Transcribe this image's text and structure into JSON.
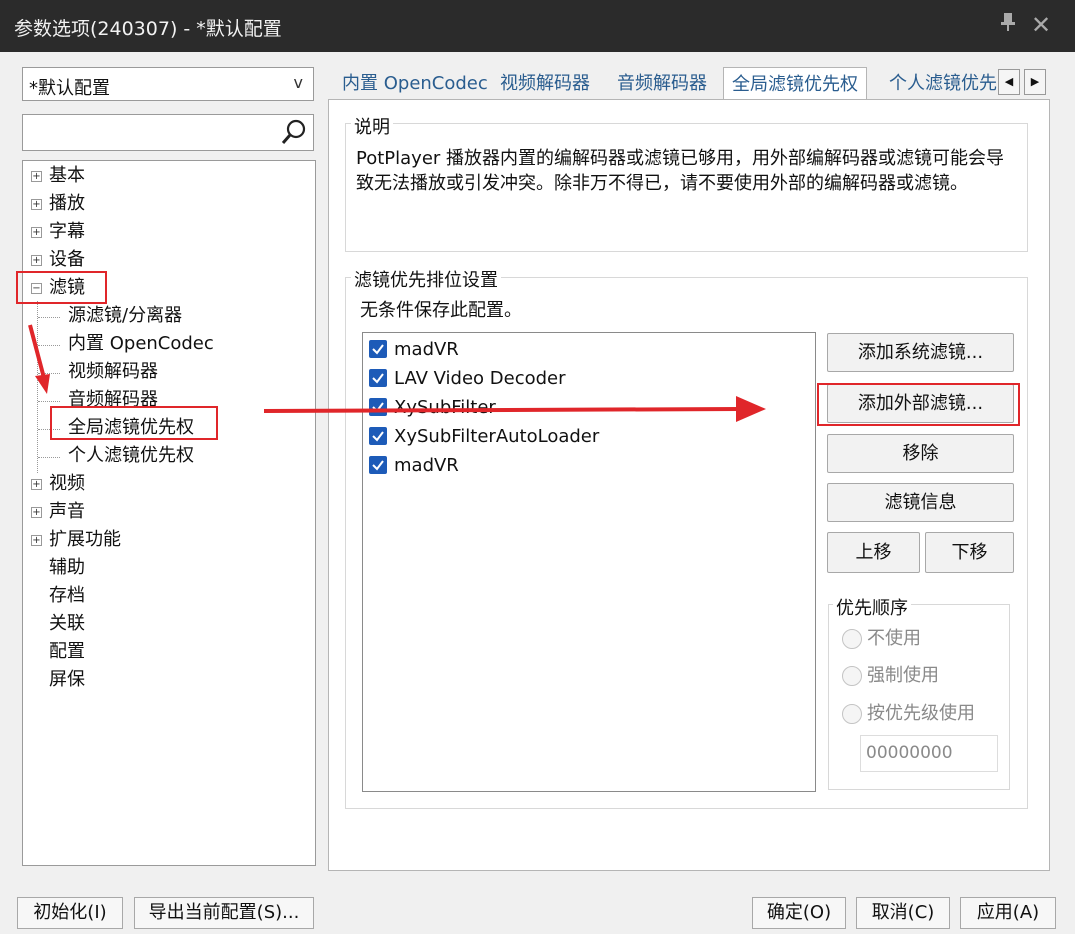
{
  "window": {
    "title": "参数选项(240307) - *默认配置"
  },
  "left": {
    "preset": "*默认配置",
    "dropdown_glyph": "v",
    "search_value": "",
    "tree": {
      "basic": "基本",
      "playback": "播放",
      "subtitle": "字幕",
      "device": "设备",
      "filter": "滤镜",
      "source_filter": "源滤镜/分离器",
      "builtin_opencodec": "内置 OpenCodec",
      "video_decoder": "视频解码器",
      "audio_decoder": "音频解码器",
      "global_priority": "全局滤镜优先权",
      "personal_priority": "个人滤镜优先权",
      "video": "视频",
      "audio": "声音",
      "extensions": "扩展功能",
      "aux": "辅助",
      "archive": "存档",
      "association": "关联",
      "config": "配置",
      "screensaver": "屏保"
    }
  },
  "tabs": [
    "内置 OpenCodec",
    "视频解码器",
    "音频解码器",
    "全局滤镜优先权",
    "个人滤镜优先"
  ],
  "description": {
    "title": "说明",
    "text": "PotPlayer 播放器内置的编解码器或滤镜已够用，用外部编解码器或滤镜可能会导致无法播放或引发冲突。除非万不得已，请不要使用外部的编解码器或滤镜。"
  },
  "priority_group": {
    "title": "滤镜优先排位设置",
    "note": "无条件保存此配置。",
    "filters": [
      {
        "name": "madVR",
        "checked": true
      },
      {
        "name": "LAV Video Decoder",
        "checked": true
      },
      {
        "name": "XySubFilter",
        "checked": true
      },
      {
        "name": "XySubFilterAutoLoader",
        "checked": true
      },
      {
        "name": "madVR",
        "checked": true
      }
    ],
    "buttons": {
      "add_system": "添加系统滤镜...",
      "add_external": "添加外部滤镜...",
      "remove": "移除",
      "info": "滤镜信息",
      "up": "上移",
      "down": "下移"
    },
    "order": {
      "title": "优先顺序",
      "options": [
        "不使用",
        "强制使用",
        "按优先级使用"
      ],
      "value": "00000000"
    }
  },
  "footer": {
    "reset": "初始化(I)",
    "export": "导出当前配置(S)...",
    "ok": "确定(O)",
    "cancel": "取消(C)",
    "apply": "应用(A)"
  },
  "colors": {
    "annotation_red": "#e0262a",
    "checkbox_blue": "#1d5bb8",
    "title_bar": "#2b2b2b",
    "tab_text": "#2a5d8f"
  }
}
